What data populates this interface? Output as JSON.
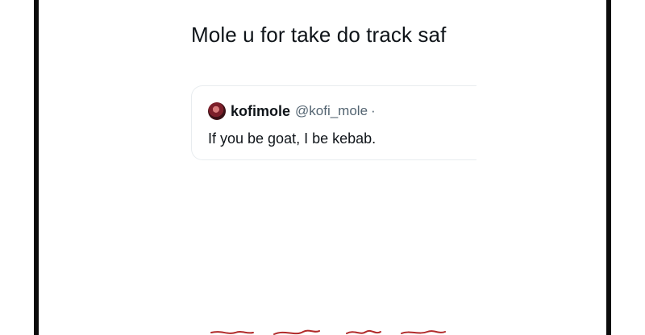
{
  "post": {
    "text": "Mole u for take do track saf"
  },
  "quote": {
    "display_name": "kofimole",
    "handle": "@kofi_mole",
    "separator": "·",
    "text": "If you be goat, I be kebab."
  },
  "signature": {
    "text": ""
  },
  "colors": {
    "text_primary": "#0f1419",
    "text_secondary": "#536471",
    "card_border": "#e8ecef",
    "frame_border": "#0b0b0b",
    "signature_red": "#b12b2b"
  }
}
